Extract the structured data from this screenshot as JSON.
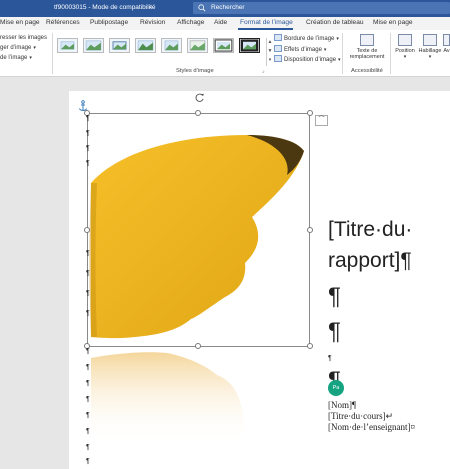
{
  "titlebar": {
    "document_title": "tf90003015  -  Mode de compatibilité",
    "search_placeholder": "Rechercher"
  },
  "tabs": [
    {
      "label": "Mise en page"
    },
    {
      "label": "Références"
    },
    {
      "label": "Publipostage"
    },
    {
      "label": "Révision"
    },
    {
      "label": "Affichage"
    },
    {
      "label": "Aide"
    },
    {
      "label": "Format de l’image",
      "active": true
    },
    {
      "label": "Création de tableau"
    },
    {
      "label": "Mise en page"
    }
  ],
  "ribbon": {
    "left_items": [
      "resser les images",
      "ger d’image",
      "de l’image"
    ],
    "picture_styles_group": "Styles d’image",
    "format_buttons": [
      "Bordure de l’image",
      "Effets d’image",
      "Disposition d’image"
    ],
    "alt_text_button": "Texte de remplacement",
    "accessibility_group": "Accessibilité",
    "position_button": "Position",
    "wrap_button": "Habillage",
    "truncated_button": "Av",
    "colors": {
      "accent": "#2b579a",
      "title_bar": "#2b579a"
    }
  },
  "document": {
    "title_line1": "[Titre·du·",
    "title_line2": "rapport]¶",
    "pilcrow": "¶",
    "small_pilcrow": "¶",
    "name_field": "[Nom]¶",
    "course_field": "[Titre·du·cours]↵",
    "teacher_field": "[Nom·de·l’enseignant]¤",
    "comment_avatar": "Pa"
  }
}
